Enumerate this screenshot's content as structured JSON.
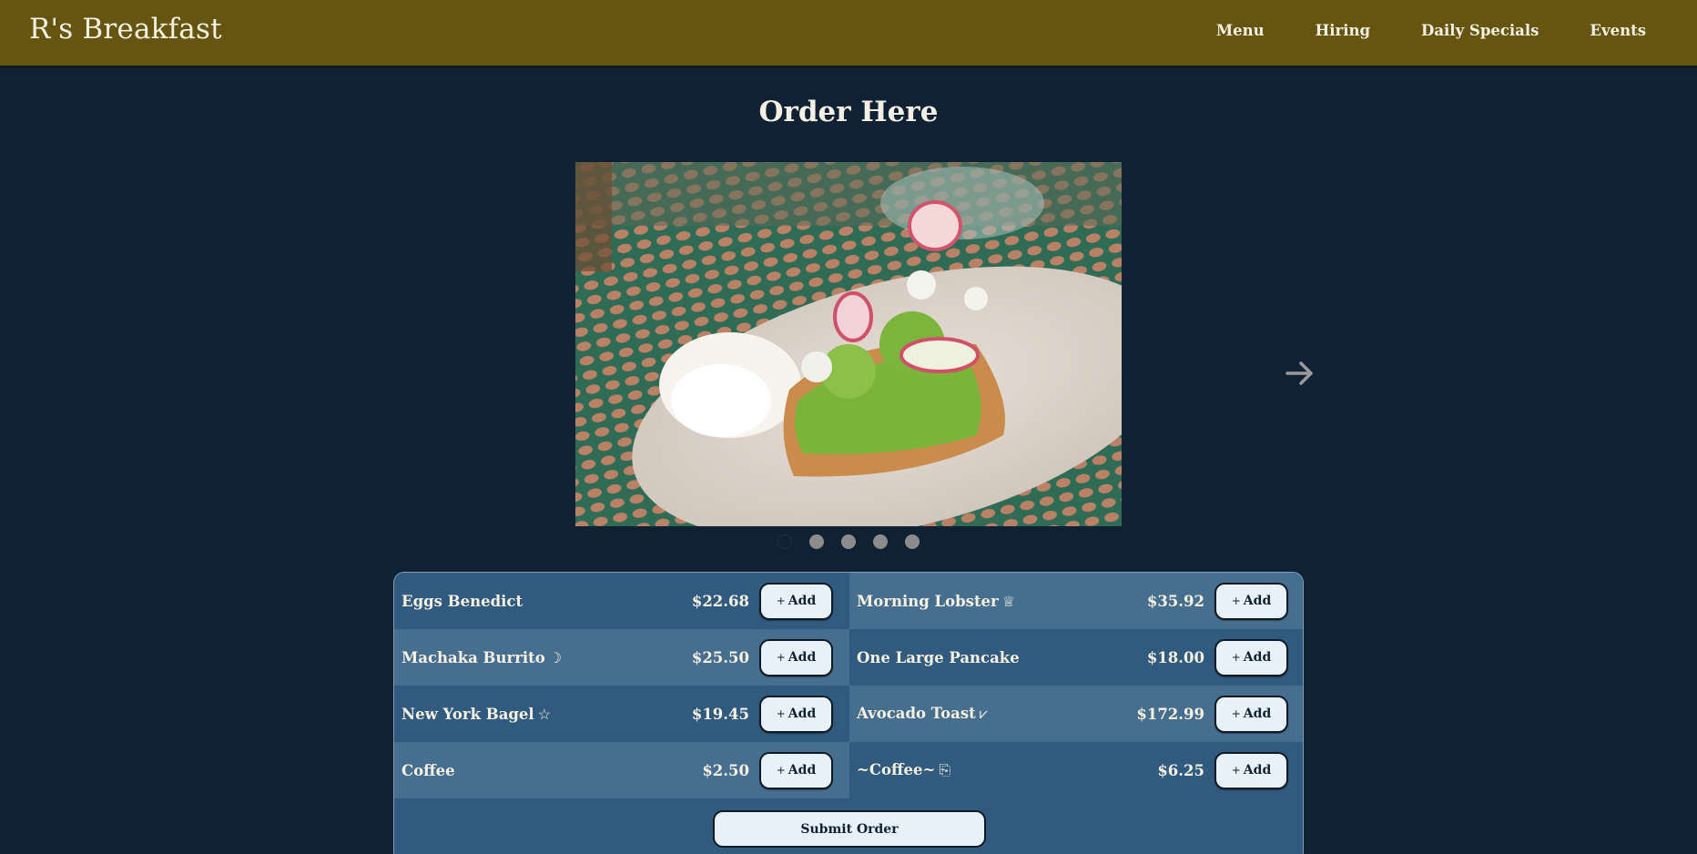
{
  "header": {
    "brand": "R's Breakfast",
    "nav": [
      "Menu",
      "Hiring",
      "Daily Specials",
      "Events"
    ],
    "background_color": "#665511"
  },
  "main": {
    "title": "Order Here",
    "carousel": {
      "image_icon": "avocado-toast-photo",
      "next_icon": "arrow-right-icon",
      "dot_count": 5,
      "active_dot": 1
    },
    "menu": [
      {
        "name": "Eggs Benedict",
        "symbol": "",
        "price": "$22.68"
      },
      {
        "name": "Morning Lobster",
        "symbol": "♕",
        "price": "$35.92"
      },
      {
        "name": "Machaka Burrito",
        "symbol": "☽",
        "price": "$25.50"
      },
      {
        "name": "One Large Pancake",
        "symbol": "",
        "price": "$18.00"
      },
      {
        "name": "New York Bagel",
        "symbol": "☆",
        "price": "$19.45"
      },
      {
        "name": "Avocado Toast",
        "symbol": "⩗",
        "price": "$172.99"
      },
      {
        "name": "Coffee",
        "symbol": "",
        "price": "$2.50"
      },
      {
        "name": "~Coffee~",
        "symbol": "⎘",
        "price": "$6.25"
      }
    ],
    "add_label": "Add",
    "add_prefix": "+",
    "submit_label": "Submit Order"
  },
  "colors": {
    "page_bg": "#0f2133",
    "panel_dark": "#305a7e",
    "panel_light": "#466f8f",
    "button_bg": "#e8f0f8"
  }
}
